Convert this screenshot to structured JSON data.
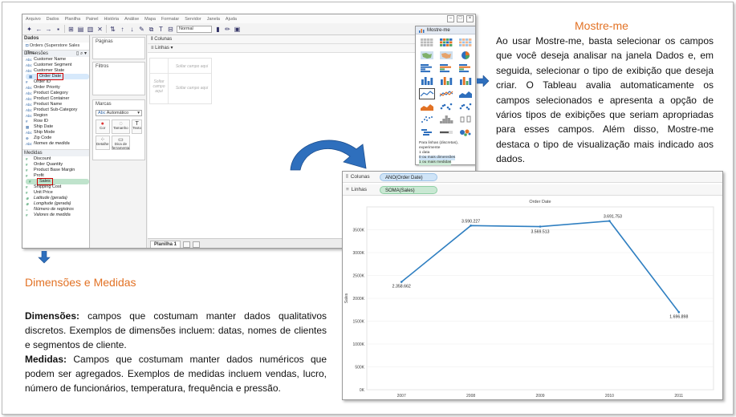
{
  "tableau1": {
    "menu": [
      "Arquivo",
      "Dados",
      "Planilha",
      "Painel",
      "História",
      "Análise",
      "Mapa",
      "Formatar",
      "Servidor",
      "Janela",
      "Ajuda"
    ],
    "toolbar_select": "Normal",
    "data_pane": {
      "title": "Dados",
      "source": "Orders (Superstore Sales (Tra...",
      "dimensions_label": "Dimensões",
      "dimensions": [
        {
          "type": "Abc",
          "name": "Customer Name"
        },
        {
          "type": "Abc",
          "name": "Customer Segment"
        },
        {
          "type": "Abc",
          "name": "Customer State"
        },
        {
          "type": "▦",
          "name": "Order Date"
        },
        {
          "type": "#",
          "name": "Order ID"
        },
        {
          "type": "Abc",
          "name": "Order Priority"
        },
        {
          "type": "Abc",
          "name": "Product Category"
        },
        {
          "type": "Abc",
          "name": "Product Container"
        },
        {
          "type": "Abc",
          "name": "Product Name"
        },
        {
          "type": "Abc",
          "name": "Product Sub-Category"
        },
        {
          "type": "Abc",
          "name": "Region"
        },
        {
          "type": "#",
          "name": "Row ID"
        },
        {
          "type": "▦",
          "name": "Ship Date"
        },
        {
          "type": "Abc",
          "name": "Ship Mode"
        },
        {
          "type": "⊕",
          "name": "Zip Code"
        },
        {
          "type": "Abc",
          "name": "Nomes de medida"
        }
      ],
      "measures_label": "Medidas",
      "measures": [
        {
          "type": "#",
          "name": "Discount"
        },
        {
          "type": "#",
          "name": "Order Quantity"
        },
        {
          "type": "#",
          "name": "Product Base Margin"
        },
        {
          "type": "#",
          "name": "Profit"
        },
        {
          "type": "#",
          "name": "Sales"
        },
        {
          "type": "#",
          "name": "Shipping Cost"
        },
        {
          "type": "#",
          "name": "Unit Price"
        },
        {
          "type": "⊕",
          "name": "Latitude (gerada)"
        },
        {
          "type": "⊕",
          "name": "Longitude (gerada)"
        },
        {
          "type": "=",
          "name": "Número de registros"
        },
        {
          "type": "#",
          "name": "Valores de medida"
        }
      ]
    },
    "pages_label": "Páginas",
    "filters_label": "Filtros",
    "marks_label": "Marcas",
    "marks_type": "Automático",
    "marks_buttons": [
      "Cor",
      "Tamanho",
      "Texto",
      "Detalhe",
      "Dica de ferramenta"
    ],
    "columns_label": "Colunas",
    "rows_label": "Linhas",
    "drop_field_top": "Soltar campo aqui",
    "drop_field_left": "Soltar campo aqui",
    "drop_field_main": "Soltar campo aqui",
    "sheet_tab": "Planilha 1",
    "showme": {
      "title": "Mostre-me",
      "footer_lines": [
        "Para linhas (discretas), experimente",
        "1 data",
        "0 ou mais dimensões",
        "1 ou mais medidas"
      ]
    }
  },
  "tableau2": {
    "columns_label": "Colunas",
    "rows_label": "Linhas",
    "columns_pill": "ANO(Order Date)",
    "rows_pill": "SOMA(Sales)"
  },
  "chart_data": {
    "type": "line",
    "title": "Order Date",
    "ylabel": "Sales",
    "categories": [
      "2007",
      "2008",
      "2009",
      "2010",
      "2011"
    ],
    "values": [
      2358662,
      3590227,
      3569513,
      3691753,
      1696898
    ],
    "data_labels": [
      "2.358.662",
      "3.590.227",
      "3.569.513",
      "3.691.753",
      "1.696.898"
    ],
    "ylim": [
      0,
      4000000
    ],
    "yticks": [
      0,
      500000,
      1000000,
      1500000,
      2000000,
      2500000,
      3000000,
      3500000
    ],
    "ytick_labels": [
      "0K",
      "500K",
      "1000K",
      "1500K",
      "2000K",
      "2500K",
      "3000K",
      "3500K"
    ],
    "grid": true,
    "line_color": "#2f7fc1"
  },
  "text": {
    "mostre_me_title": "Mostre-me",
    "mostre_me_body": "Ao usar Mostre-me, basta selecionar os campos que você deseja analisar na janela Dados e, em seguida, selecionar o tipo de exibição que deseja criar. O Tableau avalia automaticamente os campos selecionados e apresenta a opção de vários tipos de exibições que seriam apropriadas para esses campos. Além disso, Mostre-me destaca o tipo de visualização mais indicado aos dados.",
    "dim_med_title": "Dimensões e Medidas",
    "dimensoes_label": "Dimensões:",
    "dimensoes_body": " campos que costumam manter dados qualitativos discretos. Exemplos de dimensões incluem: datas, nomes de clientes e segmentos de cliente.",
    "medidas_label": "Medidas:",
    "medidas_body": " Campos que costumam manter dados numéricos que podem ser agregados. Exemplos de medidas incluem vendas, lucro, número de funcionários, temperatura, frequência e pressão."
  },
  "colors": {
    "heading": "#e27225",
    "arrow_blue": "#2e6fbd",
    "highlight_red": "#d00000"
  }
}
